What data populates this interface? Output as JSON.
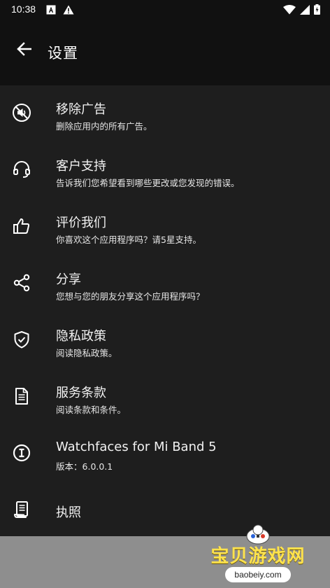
{
  "status_bar": {
    "time": "10:38",
    "left_icons": [
      "a-box-icon",
      "warning-icon"
    ],
    "right_icons": [
      "wifi-icon",
      "signal-icon",
      "battery-icon"
    ]
  },
  "app_bar": {
    "title": "设置",
    "back_icon": "arrow-left-icon"
  },
  "items": [
    {
      "icon": "no-ads-icon",
      "title": "移除广告",
      "subtitle": "删除应用内的所有广告。"
    },
    {
      "icon": "headset-icon",
      "title": "客户支持",
      "subtitle": "告诉我们您希望看到哪些更改或您发现的错误。"
    },
    {
      "icon": "thumbs-up-icon",
      "title": "评价我们",
      "subtitle": "你喜欢这个应用程序吗？请5星支持。"
    },
    {
      "icon": "share-icon",
      "title": "分享",
      "subtitle": "您想与您的朋友分享这个应用程序吗？"
    },
    {
      "icon": "shield-check-icon",
      "title": "隐私政策",
      "subtitle": "阅读隐私政策。"
    },
    {
      "icon": "document-icon",
      "title": "服务条款",
      "subtitle": "阅读条款和条件。"
    },
    {
      "icon": "info-icon",
      "title": "Watchfaces for Mi Band 5",
      "version_label": "版本：",
      "version_value": "6.0.0.1"
    },
    {
      "icon": "license-icon",
      "title": "执照"
    }
  ],
  "watermark": {
    "title": "宝贝游戏网",
    "domain": "baobeiy.com"
  },
  "colors": {
    "background": "#1e1e1e",
    "app_bar": "#111111",
    "text": "#ffffff",
    "watermark_yellow": "#ffe34d"
  }
}
